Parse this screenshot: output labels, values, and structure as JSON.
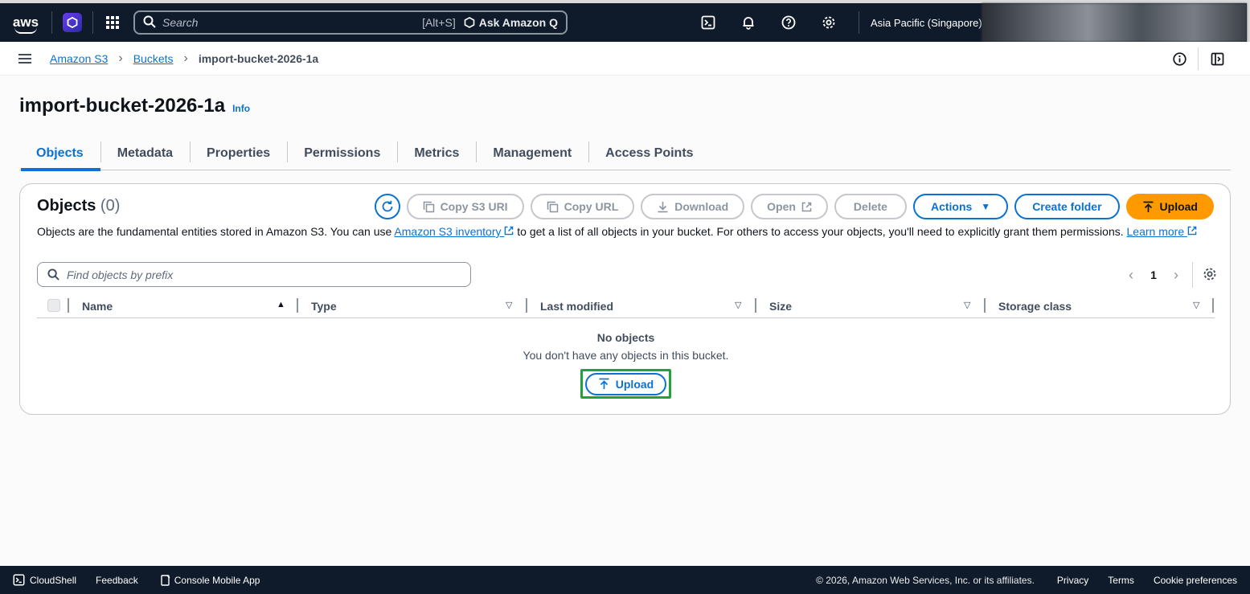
{
  "topnav": {
    "logo_text": "aws",
    "search_placeholder": "Search",
    "search_shortcut": "[Alt+S]",
    "ask_q_label": "Ask Amazon Q",
    "region_label": "Asia Pacific (Singapore)"
  },
  "breadcrumb": {
    "items": [
      "Amazon S3",
      "Buckets"
    ],
    "current": "import-bucket-2026-1a"
  },
  "header": {
    "title": "import-bucket-2026-1a",
    "info": "Info"
  },
  "tabs": [
    "Objects",
    "Metadata",
    "Properties",
    "Permissions",
    "Metrics",
    "Management",
    "Access Points"
  ],
  "objects": {
    "title": "Objects",
    "count": "(0)",
    "buttons": {
      "copy_s3_uri": "Copy S3 URI",
      "copy_url": "Copy URL",
      "download": "Download",
      "open": "Open",
      "delete": "Delete",
      "actions": "Actions",
      "create_folder": "Create folder",
      "upload": "Upload"
    },
    "description_prefix": "Objects are the fundamental entities stored in Amazon S3. You can use ",
    "inventory_link": "Amazon S3 inventory",
    "description_middle": " to get a list of all objects in your bucket. For others to access your objects, you'll need to explicitly grant them permissions. ",
    "learn_more": "Learn more",
    "filter_placeholder": "Find objects by prefix",
    "page_number": "1",
    "columns": [
      "Name",
      "Type",
      "Last modified",
      "Size",
      "Storage class"
    ],
    "empty_title": "No objects",
    "empty_message": "You don't have any objects in this bucket.",
    "empty_upload": "Upload"
  },
  "footer": {
    "cloudshell": "CloudShell",
    "feedback": "Feedback",
    "mobile_app": "Console Mobile App",
    "copyright": "© 2026, Amazon Web Services, Inc. or its affiliates.",
    "privacy": "Privacy",
    "terms": "Terms",
    "cookies": "Cookie preferences"
  },
  "colors": {
    "nav_bg": "#0f1b2a",
    "link_blue": "#0972d3",
    "upload_orange": "#ff9900",
    "highlight_green": "#1fa33a"
  }
}
